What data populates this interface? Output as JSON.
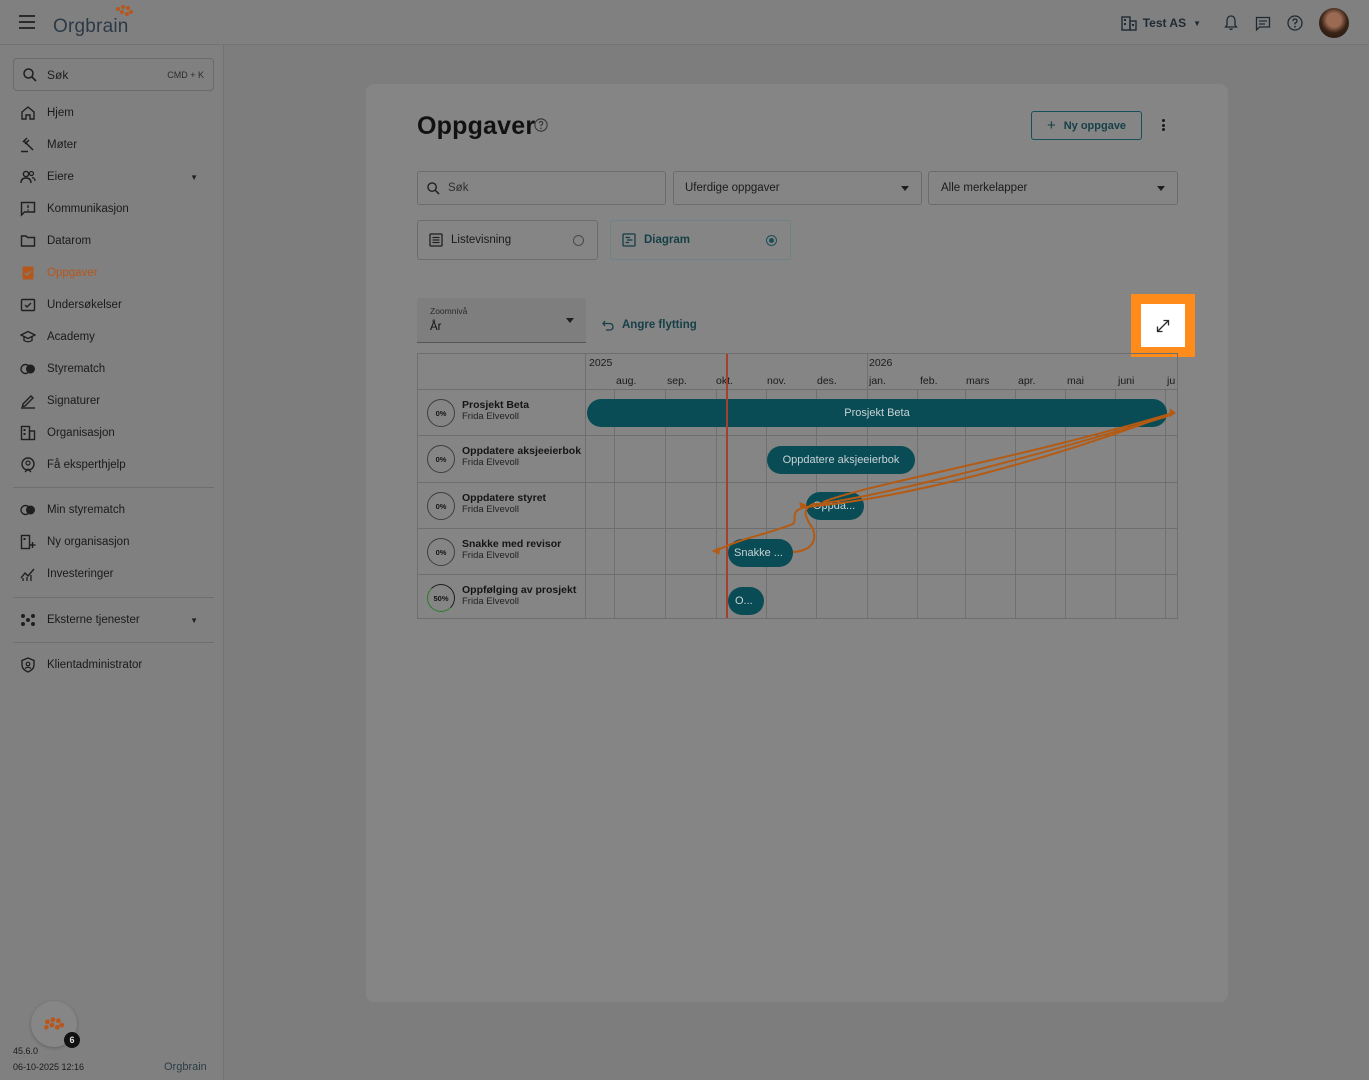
{
  "app": {
    "logo_text": "Orgbrain",
    "company": "Test AS"
  },
  "sidebar": {
    "search_label": "Søk",
    "search_shortcut": "CMD + K",
    "items": [
      {
        "label": "Hjem",
        "icon": "home-icon"
      },
      {
        "label": "Møter",
        "icon": "gavel-icon"
      },
      {
        "label": "Eiere",
        "icon": "owners-icon"
      },
      {
        "label": "Kommunikasjon",
        "icon": "message-icon"
      },
      {
        "label": "Datarom",
        "icon": "folder-icon"
      },
      {
        "label": "Oppgaver",
        "icon": "task-icon"
      },
      {
        "label": "Undersøkelser",
        "icon": "survey-icon"
      },
      {
        "label": "Academy",
        "icon": "school-icon"
      },
      {
        "label": "Styrematch",
        "icon": "match-icon"
      },
      {
        "label": "Signaturer",
        "icon": "signature-icon"
      },
      {
        "label": "Organisasjon",
        "icon": "building-icon"
      },
      {
        "label": "Få eksperthjelp",
        "icon": "expert-icon"
      }
    ],
    "secondary_items": [
      {
        "label": "Min styrematch",
        "icon": "match-icon"
      },
      {
        "label": "Ny organisasjon",
        "icon": "add-building-icon"
      },
      {
        "label": "Investeringer",
        "icon": "chart-icon"
      }
    ],
    "external_services": "Eksterne tjenester",
    "client_admin": "Klientadministrator",
    "notification_count": "6",
    "version": "45.6.0",
    "datetime": "06-10-2025 12:16",
    "footer_logo": "Orgbrain"
  },
  "main": {
    "title": "Oppgaver",
    "new_task_button": "Ny oppgave",
    "search_placeholder": "Søk",
    "status_filter": "Uferdige oppgaver",
    "tag_filter": "Alle merkelapper",
    "view_list": "Listevisning",
    "view_diagram": "Diagram",
    "zoom_label": "Zoomnivå",
    "zoom_value": "År",
    "undo_label": "Angre flytting"
  },
  "gantt": {
    "years": [
      "2025",
      "2026"
    ],
    "months": [
      "aug.",
      "sep.",
      "okt.",
      "nov.",
      "des.",
      "jan.",
      "feb.",
      "mars",
      "apr.",
      "mai",
      "juni",
      "ju"
    ],
    "tasks": [
      {
        "name": "Prosjekt Beta",
        "owner": "Frida Elvevoll",
        "progress": "0%",
        "bar_label": "Prosjekt Beta",
        "start": "2025-07-01",
        "end": "2026-07-01"
      },
      {
        "name": "Oppdatere aksjeeierbok",
        "owner": "Frida Elvevoll",
        "progress": "0%",
        "bar_label": "Oppdatere aksjeeierbok",
        "start": "2025-11-01",
        "end": "2026-01-01"
      },
      {
        "name": "Oppdatere styret",
        "owner": "Frida Elvevoll",
        "progress": "0%",
        "bar_label": "Oppda...",
        "start": "2025-11-20",
        "end": "2025-12-27"
      },
      {
        "name": "Snakke med revisor",
        "owner": "Frida Elvevoll",
        "progress": "0%",
        "bar_label": "Snakke ...",
        "start": "2025-10-06",
        "end": "2025-11-12"
      },
      {
        "name": "Oppfølging av prosjekt",
        "owner": "Frida Elvevoll",
        "progress": "50%",
        "bar_label": "O...",
        "start": "2025-10-06",
        "end": "2025-10-28"
      }
    ],
    "today": "2025-10-06"
  },
  "colors": {
    "accent": "#ff8c1a",
    "bar": "#094c55",
    "today_line": "#a5402e",
    "dependency": "#b45a12"
  }
}
